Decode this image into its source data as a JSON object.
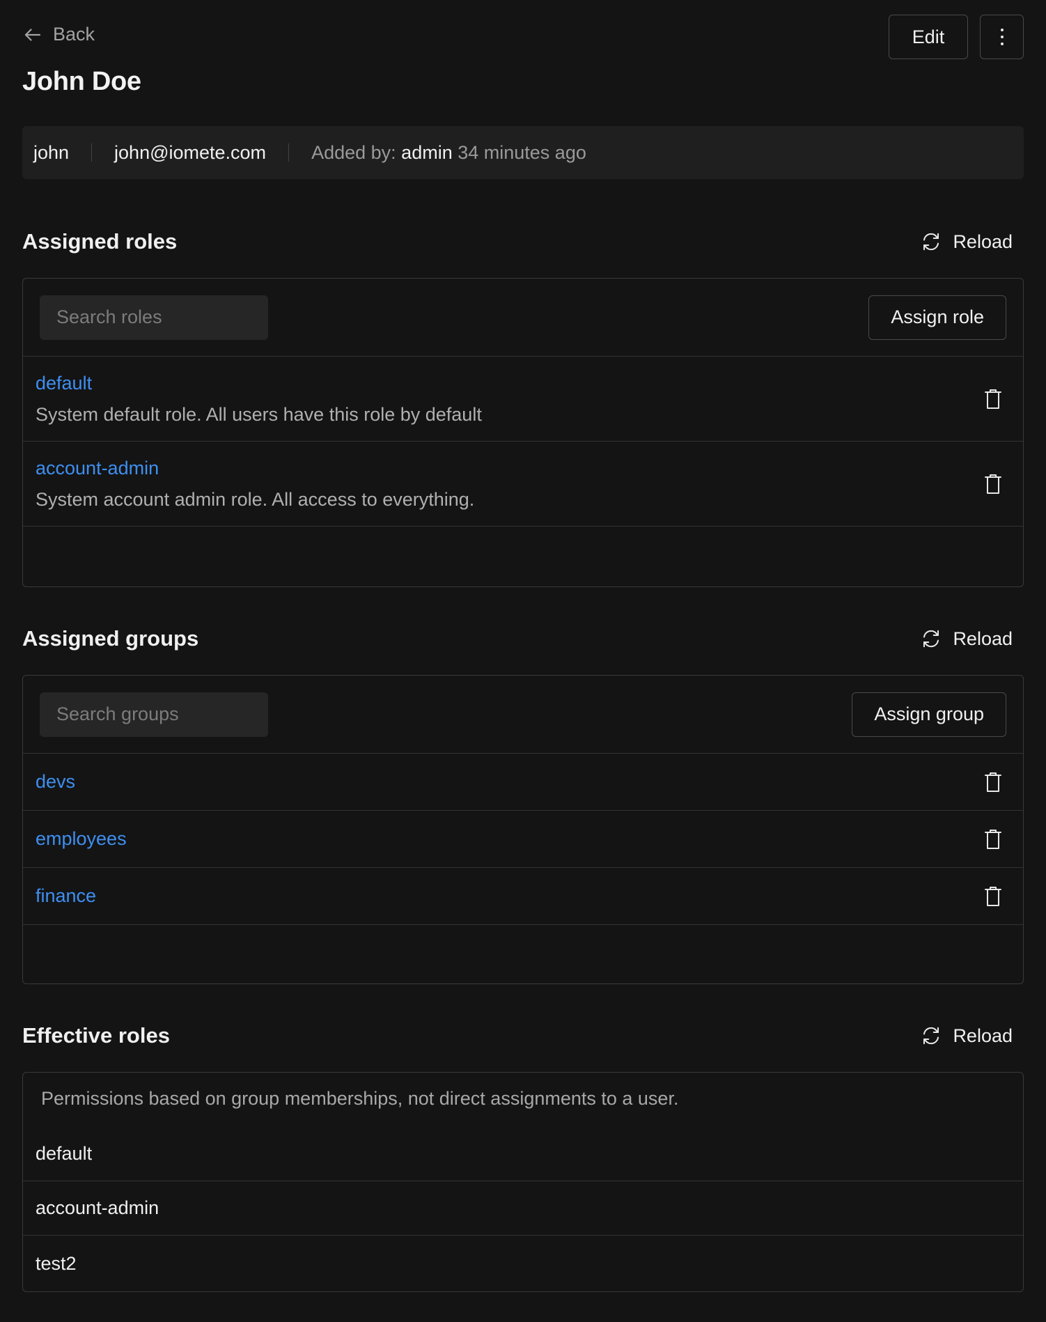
{
  "header": {
    "back_label": "Back",
    "edit_label": "Edit",
    "title": "John Doe"
  },
  "info": {
    "username": "john",
    "email": "john@iomete.com",
    "added_by_label": "Added by:",
    "added_by_user": "admin",
    "added_time": "34 minutes ago"
  },
  "roles": {
    "title": "Assigned roles",
    "reload_label": "Reload",
    "search_placeholder": "Search roles",
    "assign_label": "Assign role",
    "items": [
      {
        "name": "default",
        "description": "System default role. All users have this role by default"
      },
      {
        "name": "account-admin",
        "description": "System account admin role. All access to everything."
      }
    ]
  },
  "groups": {
    "title": "Assigned groups",
    "reload_label": "Reload",
    "search_placeholder": "Search groups",
    "assign_label": "Assign group",
    "items": [
      {
        "name": "devs"
      },
      {
        "name": "employees"
      },
      {
        "name": "finance"
      }
    ]
  },
  "effective": {
    "title": "Effective roles",
    "reload_label": "Reload",
    "note": "Permissions based on group memberships, not direct assignments to a user.",
    "items": [
      {
        "name": "default"
      },
      {
        "name": "account-admin"
      },
      {
        "name": "test2"
      }
    ]
  },
  "colors": {
    "background": "#141414",
    "link": "#3e8ff0",
    "panel": "#1f1f1f"
  }
}
